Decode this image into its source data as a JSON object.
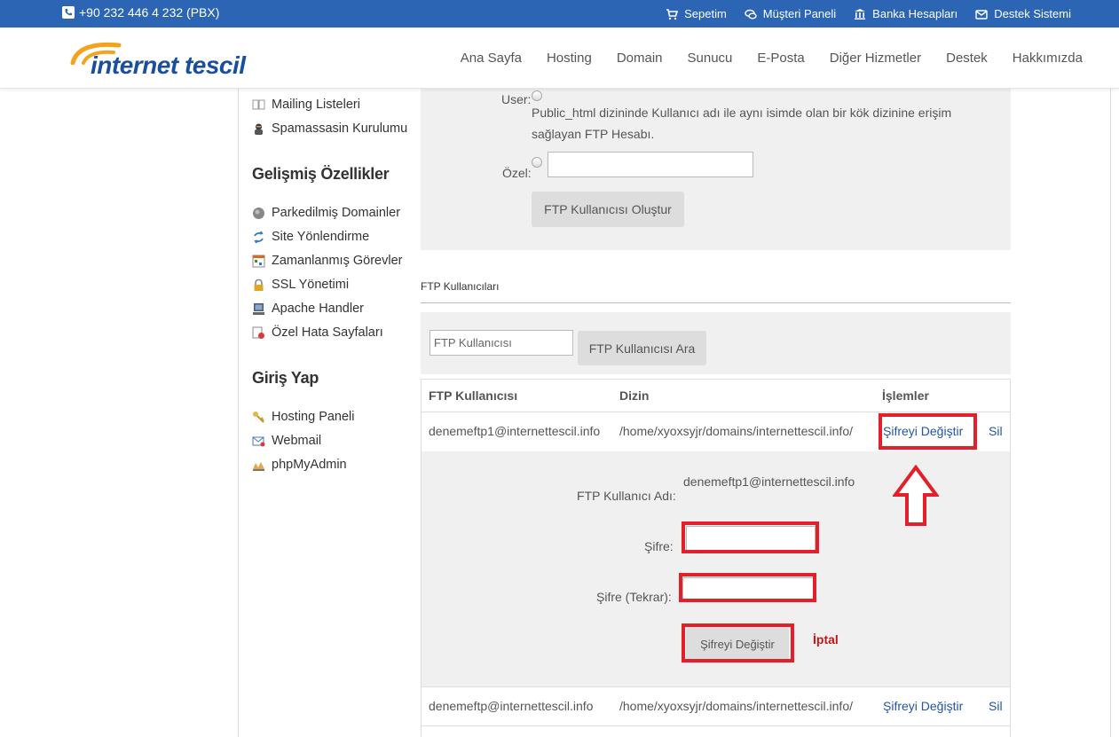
{
  "topbar": {
    "phone": "+90 232 446 4 232 (PBX)",
    "links": [
      "Sepetim",
      "Müşteri Paneli",
      "Banka Hesapları",
      "Destek Sistemi"
    ]
  },
  "header": {
    "logo_text": "internet tescil",
    "nav": [
      "Ana Sayfa",
      "Hosting",
      "Domain",
      "Sunucu",
      "E-Posta",
      "Diğer Hizmetler",
      "Destek",
      "Hakkımızda"
    ]
  },
  "sidebar": {
    "items_top": [
      "Mailing Listeleri",
      "Spamassasin Kurulumu"
    ],
    "advanced_heading": "Gelişmiş Özellikler",
    "advanced_items": [
      "Parkedilmiş Domainler",
      "Site Yönlendirme",
      "Zamanlanmış Görevler",
      "SSL Yönetimi",
      "Apache Handler",
      "Özel Hata Sayfaları"
    ],
    "login_heading": "Giriş Yap",
    "login_items": [
      "Hosting Paneli",
      "Webmail",
      "phpMyAdmin"
    ]
  },
  "create_form": {
    "user_label": "User:",
    "user_desc_line1": "Public_html dizininde Kullanıcı adı ile aynı isimde olan bir kök dizinine erişim",
    "user_desc_line2": "sağlayan FTP Hesabı.",
    "custom_label": "Özel:",
    "custom_value": "",
    "create_button": "FTP Kullanıcısı Oluştur"
  },
  "ftp_users": {
    "section_title": "FTP Kullanıcıları",
    "search_placeholder": "FTP Kullanıcısı",
    "search_button": "FTP Kullanıcısı Ara",
    "columns": [
      "FTP Kullanıcısı",
      "Dizin",
      "İşlemler"
    ],
    "rows": [
      {
        "user": "denemeftp1@internettescil.info",
        "dir": "/home/xyoxsyjr/domains/internettescil.info/",
        "change": "Şifreyi Değiştir",
        "delete": "Sil"
      },
      {
        "user": "denemeftp@internettescil.info",
        "dir": "/home/xyoxsyjr/domains/internettescil.info/",
        "change": "Şifreyi Değiştir",
        "delete": "Sil"
      }
    ],
    "edit": {
      "username_label": "FTP Kullanıcı Adı:",
      "username_value": "denemeftp1@internettescil.info",
      "password_label": "Şifre:",
      "password_repeat_label": "Şifre (Tekrar):",
      "submit_button": "Şifreyi Değiştir",
      "cancel_link": "İptal"
    }
  },
  "colors": {
    "topbar": "#2b65b3",
    "highlight": "#e3202a",
    "link": "#2255a4",
    "panel": "#f0f0f0"
  }
}
